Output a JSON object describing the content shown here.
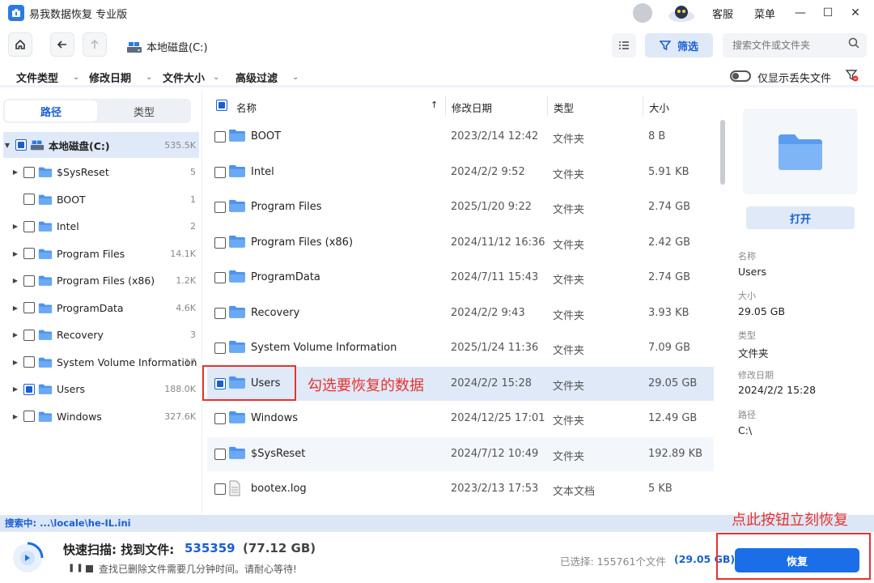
{
  "app": {
    "title": "易我数据恢复 专业版",
    "service": "客服",
    "menu": "菜单"
  },
  "nav": {
    "path": "本地磁盘(C:)",
    "filter_label": "筛选",
    "search_placeholder": "搜索文件或文件夹"
  },
  "filters": {
    "items": [
      "文件类型",
      "修改日期",
      "文件大小",
      "高级过滤"
    ],
    "show_lost_only": "仅显示丢失文件"
  },
  "tabs": {
    "path": "路径",
    "type": "类型"
  },
  "tree": [
    {
      "name": "本地磁盘(C:)",
      "count": "535.5K",
      "checked": true,
      "selected": true,
      "root": true
    },
    {
      "name": "$SysReset",
      "count": "5",
      "checked": false
    },
    {
      "name": "BOOT",
      "count": "1",
      "checked": false,
      "leaf": true
    },
    {
      "name": "Intel",
      "count": "2",
      "checked": false
    },
    {
      "name": "Program Files",
      "count": "14.1K",
      "checked": false
    },
    {
      "name": "Program Files (x86)",
      "count": "1.2K",
      "checked": false
    },
    {
      "name": "ProgramData",
      "count": "4.6K",
      "checked": false
    },
    {
      "name": "Recovery",
      "count": "3",
      "checked": false
    },
    {
      "name": "System Volume Information",
      "count": "17",
      "checked": false
    },
    {
      "name": "Users",
      "count": "188.0K",
      "checked": true
    },
    {
      "name": "Windows",
      "count": "327.6K",
      "checked": false
    }
  ],
  "table": {
    "headers": {
      "name": "名称",
      "date": "修改日期",
      "type": "类型",
      "size": "大小"
    },
    "rows": [
      {
        "name": "BOOT",
        "date": "2023/2/14 12:42",
        "type": "文件夹",
        "size": "8 B"
      },
      {
        "name": "Intel",
        "date": "2024/2/2 9:52",
        "type": "文件夹",
        "size": "5.91 KB"
      },
      {
        "name": "Program Files",
        "date": "2025/1/20 9:22",
        "type": "文件夹",
        "size": "2.74 GB"
      },
      {
        "name": "Program Files (x86)",
        "date": "2024/11/12 16:36",
        "type": "文件夹",
        "size": "2.42 GB"
      },
      {
        "name": "ProgramData",
        "date": "2024/7/11 15:43",
        "type": "文件夹",
        "size": "2.74 GB"
      },
      {
        "name": "Recovery",
        "date": "2024/2/2 9:43",
        "type": "文件夹",
        "size": "3.93 KB"
      },
      {
        "name": "System Volume Information",
        "date": "2025/1/24 11:36",
        "type": "文件夹",
        "size": "7.09 GB"
      },
      {
        "name": "Users",
        "date": "2024/2/2 15:28",
        "type": "文件夹",
        "size": "29.05 GB",
        "checked": true,
        "selected": true
      },
      {
        "name": "Windows",
        "date": "2024/12/25 17:01",
        "type": "文件夹",
        "size": "12.49 GB"
      },
      {
        "name": "$SysReset",
        "date": "2024/7/12 10:49",
        "type": "文件夹",
        "size": "192.89 KB",
        "alt": true
      },
      {
        "name": "bootex.log",
        "date": "2023/2/13 17:53",
        "type": "文本文档",
        "size": "5 KB",
        "file": true
      }
    ]
  },
  "annotations": {
    "check_hint": "勾选要恢复的数据",
    "button_hint": "点此按钮立刻恢复"
  },
  "details": {
    "open_label": "打开",
    "name_label": "名称",
    "name_value": "Users",
    "size_label": "大小",
    "size_value": "29.05 GB",
    "type_label": "类型",
    "type_value": "文件夹",
    "date_label": "修改日期",
    "date_value": "2024/2/2 15:28",
    "path_label": "路径",
    "path_value": "C:\\"
  },
  "status": {
    "searching": "搜索中:   ...\\locale\\he-IL.ini"
  },
  "scan": {
    "title": "快速扫描: 找到文件:",
    "count": "535359",
    "size": "(77.12 GB)",
    "hint": "查找已删除文件需要几分钟时间。请耐心等待!",
    "selected_label": "已选择: 155761个文件",
    "selected_size": "(29.05 GB)",
    "recover_label": "恢复"
  },
  "colors": {
    "accent": "#1a6ee8",
    "annotation": "#e8322d",
    "selection": "#dfe9f8"
  }
}
